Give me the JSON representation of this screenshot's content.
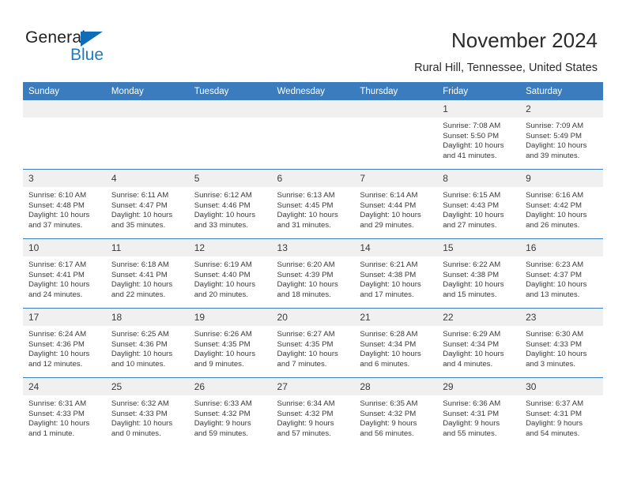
{
  "brand": {
    "name_part1": "General",
    "name_part2": "Blue",
    "triangle_color": "#0f6cb6",
    "blue_color": "#1f7ac4"
  },
  "header": {
    "title": "November 2024",
    "subtitle": "Rural Hill, Tennessee, United States",
    "header_bg": "#3a7cbd",
    "daynum_bg": "#f0f0f0"
  },
  "weekday_headers": [
    "Sunday",
    "Monday",
    "Tuesday",
    "Wednesday",
    "Thursday",
    "Friday",
    "Saturday"
  ],
  "weeks": [
    [
      {
        "day": "",
        "lines": []
      },
      {
        "day": "",
        "lines": []
      },
      {
        "day": "",
        "lines": []
      },
      {
        "day": "",
        "lines": []
      },
      {
        "day": "",
        "lines": []
      },
      {
        "day": "1",
        "lines": [
          "Sunrise: 7:08 AM",
          "Sunset: 5:50 PM",
          "Daylight: 10 hours",
          "and 41 minutes."
        ]
      },
      {
        "day": "2",
        "lines": [
          "Sunrise: 7:09 AM",
          "Sunset: 5:49 PM",
          "Daylight: 10 hours",
          "and 39 minutes."
        ]
      }
    ],
    [
      {
        "day": "3",
        "lines": [
          "Sunrise: 6:10 AM",
          "Sunset: 4:48 PM",
          "Daylight: 10 hours",
          "and 37 minutes."
        ]
      },
      {
        "day": "4",
        "lines": [
          "Sunrise: 6:11 AM",
          "Sunset: 4:47 PM",
          "Daylight: 10 hours",
          "and 35 minutes."
        ]
      },
      {
        "day": "5",
        "lines": [
          "Sunrise: 6:12 AM",
          "Sunset: 4:46 PM",
          "Daylight: 10 hours",
          "and 33 minutes."
        ]
      },
      {
        "day": "6",
        "lines": [
          "Sunrise: 6:13 AM",
          "Sunset: 4:45 PM",
          "Daylight: 10 hours",
          "and 31 minutes."
        ]
      },
      {
        "day": "7",
        "lines": [
          "Sunrise: 6:14 AM",
          "Sunset: 4:44 PM",
          "Daylight: 10 hours",
          "and 29 minutes."
        ]
      },
      {
        "day": "8",
        "lines": [
          "Sunrise: 6:15 AM",
          "Sunset: 4:43 PM",
          "Daylight: 10 hours",
          "and 27 minutes."
        ]
      },
      {
        "day": "9",
        "lines": [
          "Sunrise: 6:16 AM",
          "Sunset: 4:42 PM",
          "Daylight: 10 hours",
          "and 26 minutes."
        ]
      }
    ],
    [
      {
        "day": "10",
        "lines": [
          "Sunrise: 6:17 AM",
          "Sunset: 4:41 PM",
          "Daylight: 10 hours",
          "and 24 minutes."
        ]
      },
      {
        "day": "11",
        "lines": [
          "Sunrise: 6:18 AM",
          "Sunset: 4:41 PM",
          "Daylight: 10 hours",
          "and 22 minutes."
        ]
      },
      {
        "day": "12",
        "lines": [
          "Sunrise: 6:19 AM",
          "Sunset: 4:40 PM",
          "Daylight: 10 hours",
          "and 20 minutes."
        ]
      },
      {
        "day": "13",
        "lines": [
          "Sunrise: 6:20 AM",
          "Sunset: 4:39 PM",
          "Daylight: 10 hours",
          "and 18 minutes."
        ]
      },
      {
        "day": "14",
        "lines": [
          "Sunrise: 6:21 AM",
          "Sunset: 4:38 PM",
          "Daylight: 10 hours",
          "and 17 minutes."
        ]
      },
      {
        "day": "15",
        "lines": [
          "Sunrise: 6:22 AM",
          "Sunset: 4:38 PM",
          "Daylight: 10 hours",
          "and 15 minutes."
        ]
      },
      {
        "day": "16",
        "lines": [
          "Sunrise: 6:23 AM",
          "Sunset: 4:37 PM",
          "Daylight: 10 hours",
          "and 13 minutes."
        ]
      }
    ],
    [
      {
        "day": "17",
        "lines": [
          "Sunrise: 6:24 AM",
          "Sunset: 4:36 PM",
          "Daylight: 10 hours",
          "and 12 minutes."
        ]
      },
      {
        "day": "18",
        "lines": [
          "Sunrise: 6:25 AM",
          "Sunset: 4:36 PM",
          "Daylight: 10 hours",
          "and 10 minutes."
        ]
      },
      {
        "day": "19",
        "lines": [
          "Sunrise: 6:26 AM",
          "Sunset: 4:35 PM",
          "Daylight: 10 hours",
          "and 9 minutes."
        ]
      },
      {
        "day": "20",
        "lines": [
          "Sunrise: 6:27 AM",
          "Sunset: 4:35 PM",
          "Daylight: 10 hours",
          "and 7 minutes."
        ]
      },
      {
        "day": "21",
        "lines": [
          "Sunrise: 6:28 AM",
          "Sunset: 4:34 PM",
          "Daylight: 10 hours",
          "and 6 minutes."
        ]
      },
      {
        "day": "22",
        "lines": [
          "Sunrise: 6:29 AM",
          "Sunset: 4:34 PM",
          "Daylight: 10 hours",
          "and 4 minutes."
        ]
      },
      {
        "day": "23",
        "lines": [
          "Sunrise: 6:30 AM",
          "Sunset: 4:33 PM",
          "Daylight: 10 hours",
          "and 3 minutes."
        ]
      }
    ],
    [
      {
        "day": "24",
        "lines": [
          "Sunrise: 6:31 AM",
          "Sunset: 4:33 PM",
          "Daylight: 10 hours",
          "and 1 minute."
        ]
      },
      {
        "day": "25",
        "lines": [
          "Sunrise: 6:32 AM",
          "Sunset: 4:33 PM",
          "Daylight: 10 hours",
          "and 0 minutes."
        ]
      },
      {
        "day": "26",
        "lines": [
          "Sunrise: 6:33 AM",
          "Sunset: 4:32 PM",
          "Daylight: 9 hours",
          "and 59 minutes."
        ]
      },
      {
        "day": "27",
        "lines": [
          "Sunrise: 6:34 AM",
          "Sunset: 4:32 PM",
          "Daylight: 9 hours",
          "and 57 minutes."
        ]
      },
      {
        "day": "28",
        "lines": [
          "Sunrise: 6:35 AM",
          "Sunset: 4:32 PM",
          "Daylight: 9 hours",
          "and 56 minutes."
        ]
      },
      {
        "day": "29",
        "lines": [
          "Sunrise: 6:36 AM",
          "Sunset: 4:31 PM",
          "Daylight: 9 hours",
          "and 55 minutes."
        ]
      },
      {
        "day": "30",
        "lines": [
          "Sunrise: 6:37 AM",
          "Sunset: 4:31 PM",
          "Daylight: 9 hours",
          "and 54 minutes."
        ]
      }
    ]
  ]
}
